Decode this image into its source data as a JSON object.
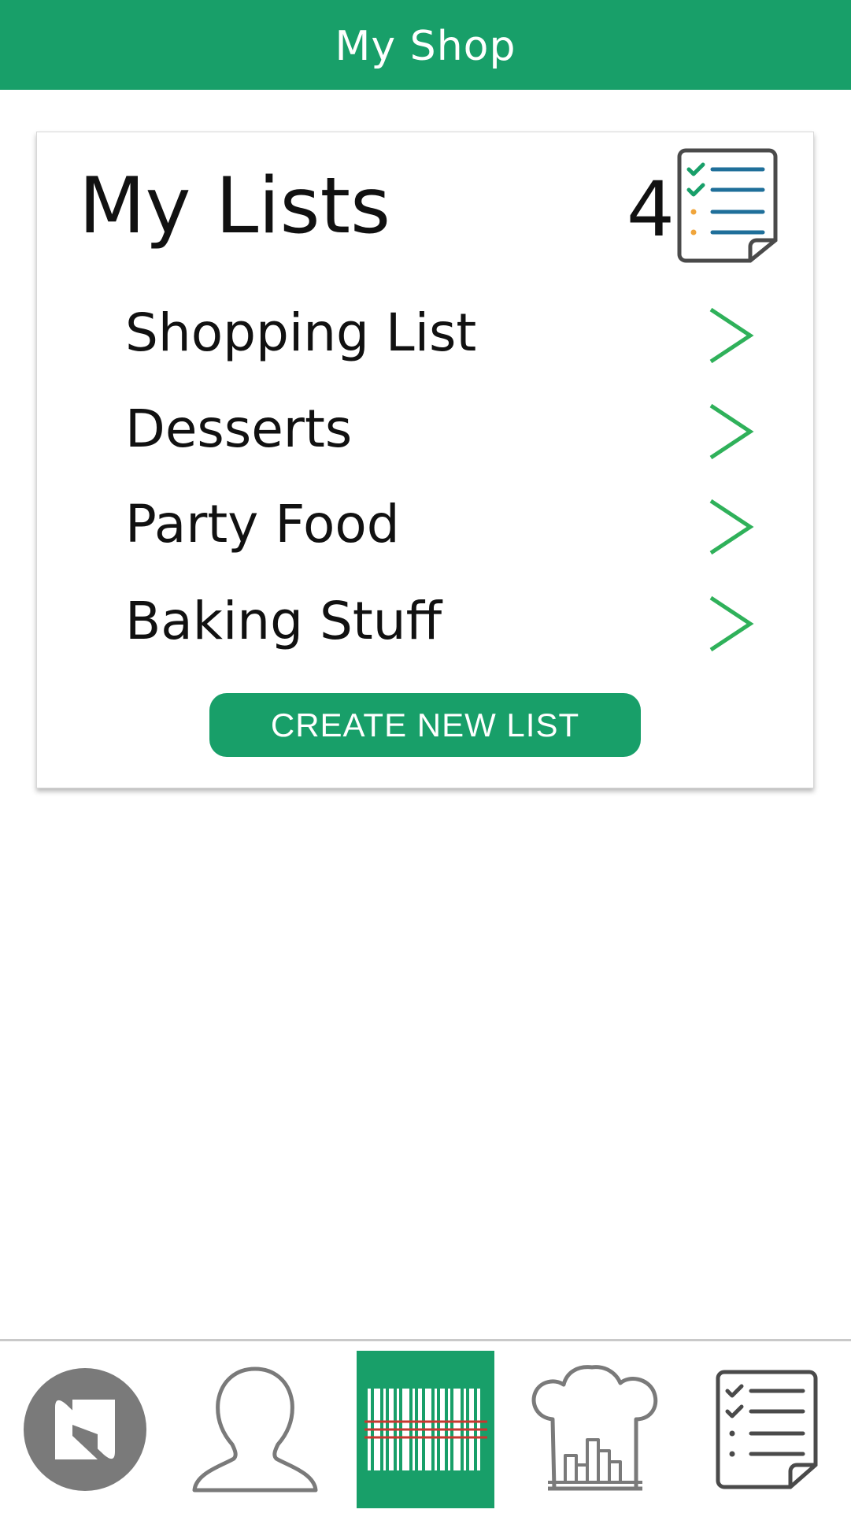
{
  "header": {
    "title": "My Shop"
  },
  "lists_card": {
    "title": "My Lists",
    "count": "4",
    "icon": "checklist-icon",
    "items": [
      {
        "label": "Shopping List",
        "icon": "chevron-right-icon"
      },
      {
        "label": "Desserts",
        "icon": "chevron-right-icon"
      },
      {
        "label": "Party Food",
        "icon": "chevron-right-icon"
      },
      {
        "label": "Baking Stuff",
        "icon": "chevron-right-icon"
      }
    ],
    "create_button_label": "CREATE NEW LIST"
  },
  "bottom_nav": {
    "items": [
      {
        "icon": "app-logo-icon",
        "active": false
      },
      {
        "icon": "profile-icon",
        "active": false
      },
      {
        "icon": "barcode-scanner-icon",
        "active": true
      },
      {
        "icon": "chef-hat-icon",
        "active": false
      },
      {
        "icon": "checklist-icon",
        "active": false
      }
    ]
  },
  "colors": {
    "brand_green": "#189f69",
    "chevron_green": "#2fb15a",
    "nav_gray": "#7a7a7a",
    "scan_red": "#c8372f",
    "list_blue": "#1f6f9a",
    "bullet_orange": "#f0a53b"
  }
}
